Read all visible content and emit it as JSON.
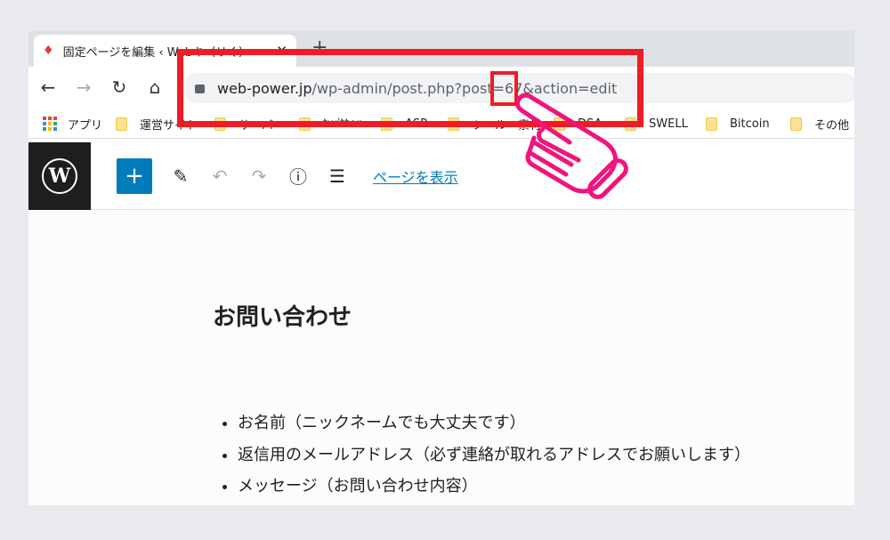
{
  "browser": {
    "tab_title": "固定ページを編集 ‹ Webキ（リく）",
    "close_icon": "close-icon",
    "new_tab": "+",
    "url_host": "web-power.jp",
    "url_path": "/wp-admin/post.php?post=67&action=edit",
    "bookmarks": [
      {
        "label": "アプリ"
      },
      {
        "label": "運営サイト"
      },
      {
        "label": "サーバー"
      },
      {
        "label": "twitter"
      },
      {
        "label": "ASP"
      },
      {
        "label": "ツール・素材"
      },
      {
        "label": "DSA"
      },
      {
        "label": "SWELL"
      },
      {
        "label": "Bitcoin"
      },
      {
        "label": "その他"
      }
    ]
  },
  "editor": {
    "view_page": "ページを表示",
    "add": "+"
  },
  "page": {
    "title": "お問い合わせ",
    "items": [
      "お名前（ニックネームでも大丈夫です）",
      "返信用のメールアドレス（必ず連絡が取れるアドレスでお願いします）",
      "メッセージ（お問い合わせ内容）"
    ]
  },
  "colors": {
    "highlight": "#ee1c25",
    "pointer": "#f0147c",
    "wp_blue": "#007cba"
  }
}
